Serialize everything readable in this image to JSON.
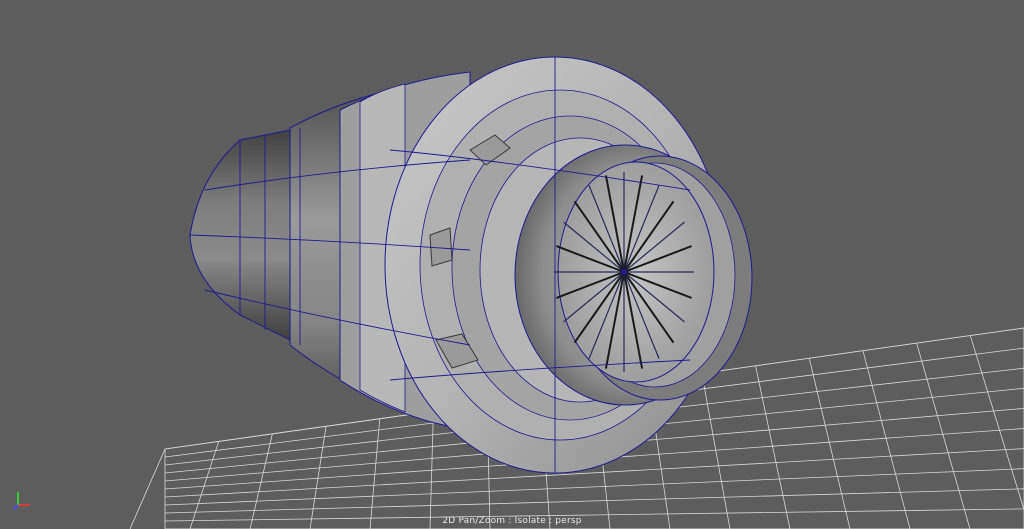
{
  "viewport": {
    "status_text": "2D Pan/Zoom : Isolate : persp",
    "camera": "persp",
    "mode": "Isolate",
    "background_color": "#5d5d5d",
    "wireframe_color": "#1c1c8c",
    "grid_color": "#d8d8d8"
  },
  "model": {
    "kind": "jet-engine-nacelle",
    "fan_blade_count": 24,
    "mounting_tab_count": 3
  },
  "gizmo": {
    "x_axis_color": "#d23c3c",
    "y_axis_color": "#3cc83c",
    "z_axis_color": "#3c50e6",
    "icon": "axis-gizmo-icon"
  }
}
